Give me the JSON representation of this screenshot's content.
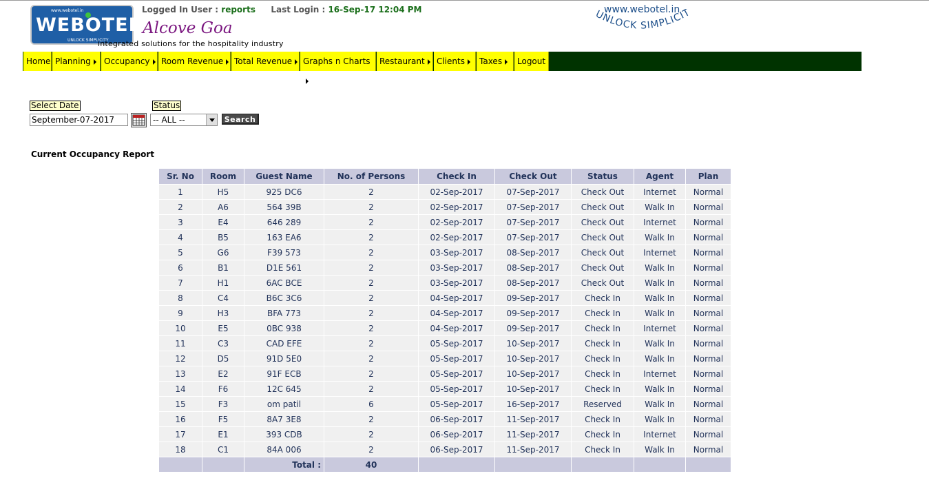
{
  "header": {
    "logo": {
      "small_text": "www.webotel.in",
      "word": "WEBOTEL",
      "tag": "UNLOCK SIMPLICITY"
    },
    "tagline": "integrated solutions for the hospitality industry",
    "logged_in_label": "Logged In User :",
    "logged_in_user": "reports",
    "last_login_label": "Last Login :",
    "last_login_value": "16-Sep-17 12:04 PM",
    "hotel_name": "Alcove Goa",
    "site_url": "www.webotel.in",
    "slogan": "UNLOCK SIMPLICITY"
  },
  "menu": [
    {
      "label": "Home",
      "has_submenu": false
    },
    {
      "label": "Planning",
      "has_submenu": true
    },
    {
      "label": "Occupancy",
      "has_submenu": true
    },
    {
      "label": "Room Revenue",
      "has_submenu": true
    },
    {
      "label": "Total Revenue",
      "has_submenu": true
    },
    {
      "label": "Graphs n Charts",
      "has_submenu": true
    },
    {
      "label": "Restaurant",
      "has_submenu": true
    },
    {
      "label": "Clients",
      "has_submenu": true
    },
    {
      "label": "Taxes",
      "has_submenu": true
    },
    {
      "label": "Logout",
      "has_submenu": false
    }
  ],
  "filters": {
    "date_label": "Select Date",
    "date_value": "September-07-2017",
    "status_label": "Status",
    "status_value": "-- ALL --",
    "search_label": "Search"
  },
  "report": {
    "title": "Current Occupancy Report",
    "columns": [
      "Sr. No",
      "Room",
      "Guest Name",
      "No. of Persons",
      "Check In",
      "Check Out",
      "Status",
      "Agent",
      "Plan"
    ],
    "rows": [
      [
        "1",
        "H5",
        "925 DC6",
        "2",
        "02-Sep-2017",
        "07-Sep-2017",
        "Check Out",
        "Internet",
        "Normal"
      ],
      [
        "2",
        "A6",
        "564 39B",
        "2",
        "02-Sep-2017",
        "07-Sep-2017",
        "Check Out",
        "Walk In",
        "Normal"
      ],
      [
        "3",
        "E4",
        "646 289",
        "2",
        "02-Sep-2017",
        "07-Sep-2017",
        "Check Out",
        "Internet",
        "Normal"
      ],
      [
        "4",
        "B5",
        "163 EA6",
        "2",
        "02-Sep-2017",
        "07-Sep-2017",
        "Check Out",
        "Walk In",
        "Normal"
      ],
      [
        "5",
        "G6",
        "F39 573",
        "2",
        "03-Sep-2017",
        "08-Sep-2017",
        "Check Out",
        "Internet",
        "Normal"
      ],
      [
        "6",
        "B1",
        "D1E 561",
        "2",
        "03-Sep-2017",
        "08-Sep-2017",
        "Check Out",
        "Walk In",
        "Normal"
      ],
      [
        "7",
        "H1",
        "6AC BCE",
        "2",
        "03-Sep-2017",
        "08-Sep-2017",
        "Check Out",
        "Walk In",
        "Normal"
      ],
      [
        "8",
        "C4",
        "B6C 3C6",
        "2",
        "04-Sep-2017",
        "09-Sep-2017",
        "Check In",
        "Walk In",
        "Normal"
      ],
      [
        "9",
        "H3",
        "BFA 773",
        "2",
        "04-Sep-2017",
        "09-Sep-2017",
        "Check In",
        "Walk In",
        "Normal"
      ],
      [
        "10",
        "E5",
        "0BC 938",
        "2",
        "04-Sep-2017",
        "09-Sep-2017",
        "Check In",
        "Internet",
        "Normal"
      ],
      [
        "11",
        "C3",
        "CAD EFE",
        "2",
        "05-Sep-2017",
        "10-Sep-2017",
        "Check In",
        "Walk In",
        "Normal"
      ],
      [
        "12",
        "D5",
        "91D 5E0",
        "2",
        "05-Sep-2017",
        "10-Sep-2017",
        "Check In",
        "Walk In",
        "Normal"
      ],
      [
        "13",
        "E2",
        "91F ECB",
        "2",
        "05-Sep-2017",
        "10-Sep-2017",
        "Check In",
        "Internet",
        "Normal"
      ],
      [
        "14",
        "F6",
        "12C 645",
        "2",
        "05-Sep-2017",
        "10-Sep-2017",
        "Check In",
        "Walk In",
        "Normal"
      ],
      [
        "15",
        "F3",
        "om patil",
        "6",
        "05-Sep-2017",
        "16-Sep-2017",
        "Reserved",
        "Walk In",
        "Normal"
      ],
      [
        "16",
        "F5",
        "8A7 3E8",
        "2",
        "06-Sep-2017",
        "11-Sep-2017",
        "Check In",
        "Walk In",
        "Normal"
      ],
      [
        "17",
        "E1",
        "393 CDB",
        "2",
        "06-Sep-2017",
        "11-Sep-2017",
        "Check In",
        "Internet",
        "Normal"
      ],
      [
        "18",
        "C1",
        "84A 006",
        "2",
        "06-Sep-2017",
        "11-Sep-2017",
        "Check In",
        "Walk In",
        "Normal"
      ]
    ],
    "total_label": "Total :",
    "total_persons": "40"
  },
  "colors": {
    "menu_bg": "#ffff00",
    "menubar_bg": "#003300",
    "table_header_bg": "#c9c9dd",
    "table_row_bg": "#f0f0f0",
    "hotel_name": "#7a157f",
    "logo_bg": "#1f5fa6"
  }
}
